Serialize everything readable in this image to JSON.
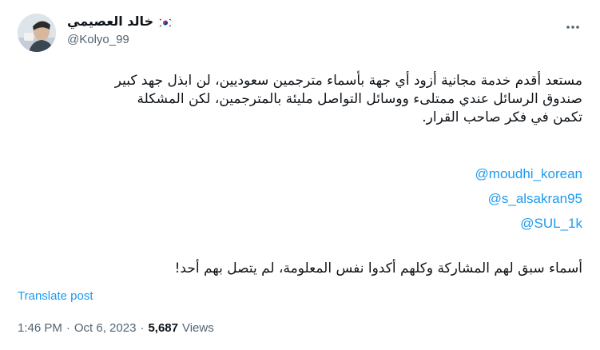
{
  "author": {
    "display_name": "خالد العصيمي",
    "flag_emoji": "south-korea-flag",
    "handle": "@Kolyo_99"
  },
  "tweet": {
    "paragraph1_line1": "مستعد أقدم خدمة مجانية أزود أي جهة بأسماء مترجمين سعوديين، لن ابذل جهد كبير",
    "paragraph1_line2": "صندوق الرسائل عندي ممتلىء ووسائل التواصل مليئة بالمترجمين، لكن المشكلة",
    "paragraph1_line3": "تكمن في فكر صاحب القرار.",
    "mentions": [
      "@moudhi_korean",
      "@s_alsakran95",
      "@SUL_1k"
    ],
    "paragraph2": "أسماء سبق لهم المشاركة وكلهم أكدوا نفس المعلومة، لم يتصل بهم أحد!",
    "translate_label": "Translate post"
  },
  "meta": {
    "time": "1:46 PM",
    "separator": "·",
    "date": "Oct 6, 2023",
    "views_count": "5,687",
    "views_label": "Views"
  },
  "colors": {
    "link": "#1d9bf0",
    "secondary": "#536471",
    "primary": "#0f1419"
  }
}
